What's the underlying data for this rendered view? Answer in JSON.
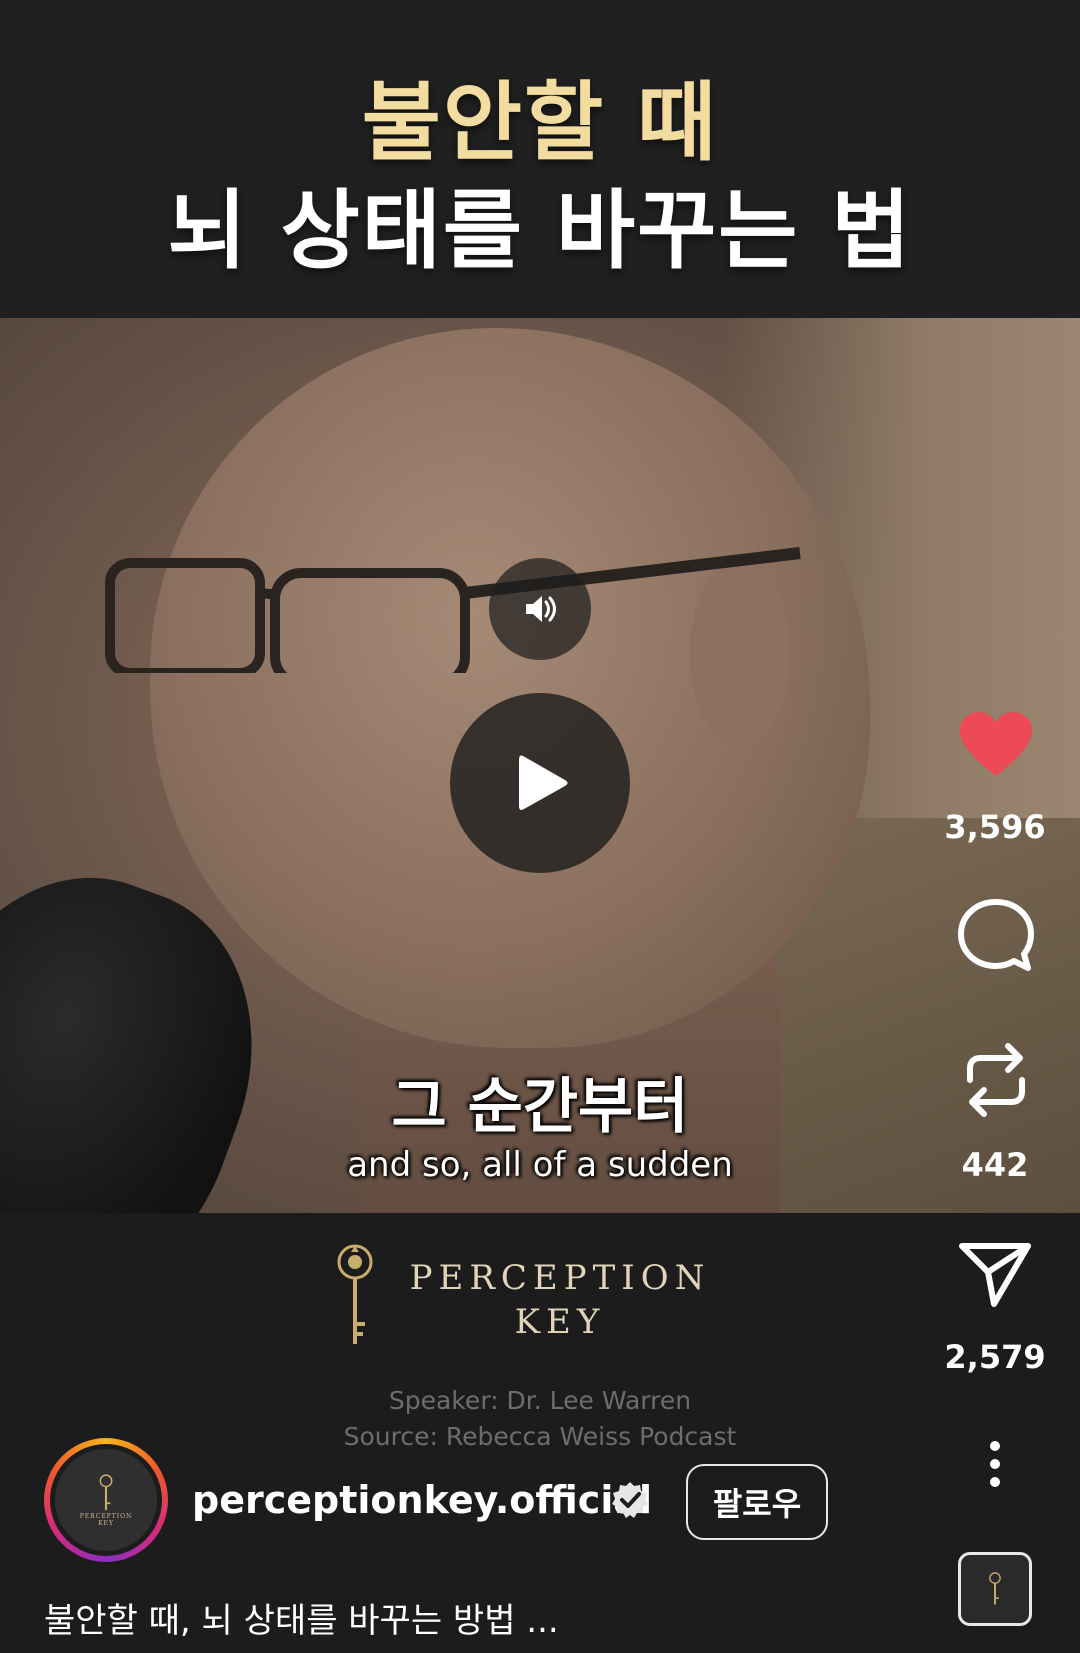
{
  "title": {
    "line1": "불안할 때",
    "line2": "뇌 상태를 바꾸는 법"
  },
  "video": {
    "subtitle_ko": "그 순간부터",
    "subtitle_en": "and so, all of a sudden",
    "sound_icon": "speaker-icon",
    "play_icon": "play-icon"
  },
  "brand": {
    "name_line1": "PERCEPTION",
    "name_line2": "KEY",
    "speaker": "Speaker: Dr. Lee Warren",
    "source": "Source: Rebecca Weiss Podcast",
    "accent": "#e1d4b8"
  },
  "actions": {
    "like_count": "3,596",
    "comment_count": "",
    "repost_count": "442",
    "share_count": "2,579",
    "like_color": "#ed4956"
  },
  "profile": {
    "username": "perceptionkey.official",
    "follow_label": "팔로우",
    "avatar_text_line1": "PERCEPTION",
    "avatar_text_line2": "KEY"
  },
  "caption": {
    "text": "불안할 때, 뇌 상태를 바꾸는 방법 ..."
  }
}
